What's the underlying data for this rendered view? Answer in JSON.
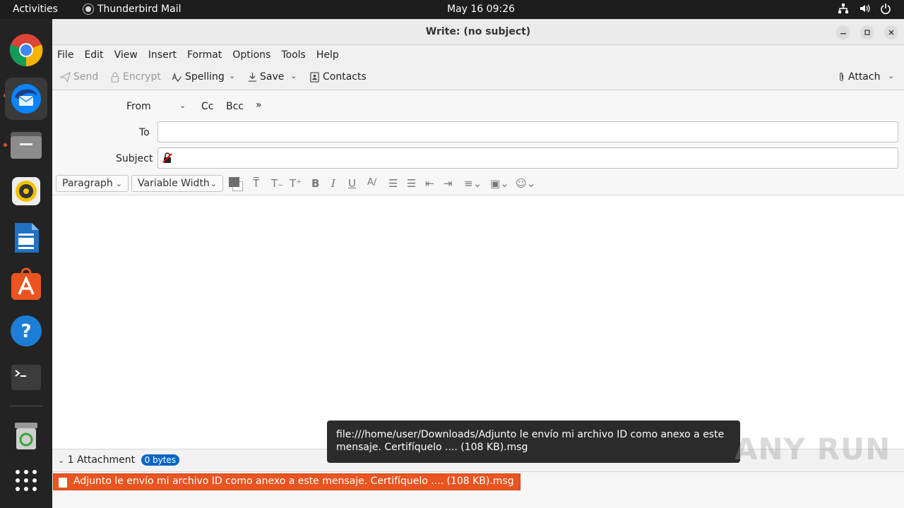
{
  "topbar": {
    "activities": "Activities",
    "app_name": "Thunderbird Mail",
    "clock": "May 16  09:26"
  },
  "dock": {
    "apps": [
      "chrome-icon",
      "thunderbird-icon",
      "files-icon",
      "rhythmbox-icon",
      "writer-icon",
      "software-icon",
      "help-icon",
      "terminal-icon",
      "trash-icon",
      "app-grid-icon"
    ]
  },
  "window": {
    "title": "Write: (no subject)"
  },
  "menu": {
    "file": "File",
    "edit": "Edit",
    "view": "View",
    "insert": "Insert",
    "format": "Format",
    "options": "Options",
    "tools": "Tools",
    "help": "Help"
  },
  "toolbar": {
    "send": "Send",
    "encrypt": "Encrypt",
    "spelling": "Spelling",
    "save": "Save",
    "contacts": "Contacts",
    "attach": "Attach"
  },
  "headers": {
    "from_label": "From",
    "cc": "Cc",
    "bcc": "Bcc",
    "to_label": "To",
    "to_value": "",
    "subject_label": "Subject",
    "subject_value": ""
  },
  "format": {
    "paragraph": "Paragraph",
    "font": "Variable Width"
  },
  "attachments": {
    "summary": "1 Attachment",
    "size_badge": "0 bytes",
    "items": [
      {
        "name": "Adjunto le envío mi archivo ID como anexo a este mensaje. Certifíquelo .... (108 KB).msg"
      }
    ]
  },
  "tooltip": {
    "text": "file:///home/user/Downloads/Adjunto le envío mi archivo ID como anexo a este mensaje. Certifíquelo .... (108 KB).msg"
  },
  "watermark": "ANY RUN"
}
